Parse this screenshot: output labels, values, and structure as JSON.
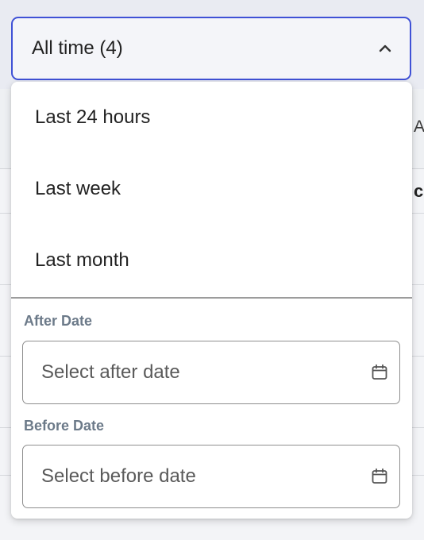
{
  "filter": {
    "selected_label": "All time (4)",
    "options": [
      {
        "label": "Last 24 hours"
      },
      {
        "label": "Last week"
      },
      {
        "label": "Last month"
      }
    ],
    "after_date": {
      "label": "After Date",
      "placeholder": "Select after date"
    },
    "before_date": {
      "label": "Before Date",
      "placeholder": "Select before date"
    }
  },
  "background_table": {
    "column_header_fragment": "A",
    "cell_fragment": "c"
  },
  "colors": {
    "accent_border": "#3f51d6",
    "label_text": "#6c7a89",
    "divider": "#9c9c9c"
  },
  "icons": {
    "trigger": "chevron-up-icon",
    "date_picker": "calendar-icon"
  }
}
